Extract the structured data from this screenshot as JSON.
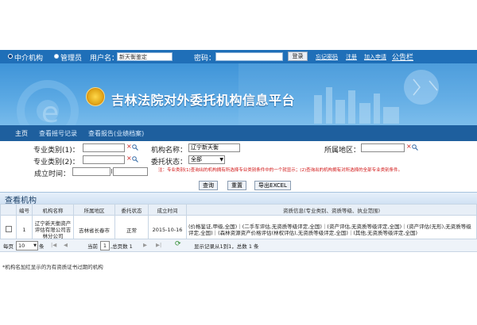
{
  "topbar": {
    "radio_agency": "中介机构",
    "radio_admin": "管理员",
    "username_label": "用户名：",
    "username_value": "新天衡鉴定",
    "password_label": "密码：",
    "login_button": "登录",
    "forgot_password": "忘记密码",
    "register": "注册",
    "join_apply": "加入申请",
    "announcement": "公告栏"
  },
  "banner": {
    "title": "吉林法院对外委托机构信息平台"
  },
  "nav": {
    "home": "主页",
    "view_record": "查看摇号记录",
    "view_report": "查看报告(业绩档案)"
  },
  "form": {
    "category1_label": "专业类别(1)：",
    "category2_label": "专业类别(2)：",
    "time_label": "成立时间：",
    "org_name_label": "机构名称：",
    "org_name_value": "辽宁新天衡",
    "status_label": "委托状态：",
    "status_value": "全部",
    "region_label": "所属地区：",
    "hint": "注：专业类别(1)查询出的机构拥有所选择专业类别条件中的一个就显示；(2)查询出的机构拥有对所选择的全部专业类别条件。",
    "query_button": "查询",
    "reset_button": "重置",
    "export_button": "导出EXCEL"
  },
  "section": {
    "title": "查看机构"
  },
  "table": {
    "headers": [
      "",
      "编号",
      "机构名称",
      "所属地区",
      "委托状态",
      "成立时间",
      "资质信息(专业类别、资质等级、执业范围)"
    ],
    "rows": [
      {
        "no": "1",
        "name": "辽宁新天衡资产评估有限公司吉林分公司",
        "region": "吉林省长春市",
        "status": "正常",
        "date": "2015-10-16",
        "qualification": "(价格鉴证,甲级,全国)｜(二手车评估,无资质等级评定,全国)｜(资产评估,无资质等级评定,全国)｜(资产评估(无形),无资质等级评定,全国)｜(森林资源资产价格评估(林权评估),无资质等级评定,全国)｜(其他,无资质等级评定,全国)"
      }
    ]
  },
  "pager": {
    "per_page_label": "每页",
    "per_page_value": "10",
    "per_page_unit": "条",
    "page_prefix": "当前",
    "page_value": "1",
    "page_suffix": ",总页数 1",
    "summary": "显示记录从1到1，总数 1 条"
  },
  "note": "*机构名加红显示的为有资质证书过期的机构"
}
